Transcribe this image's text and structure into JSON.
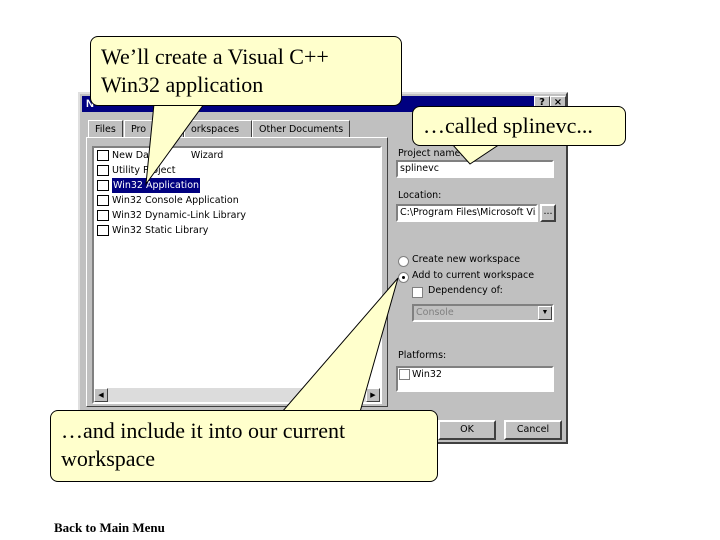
{
  "dialog": {
    "title_visible": "N",
    "title_help": "?",
    "title_close": "×",
    "tabs": [
      "Files",
      "Pro",
      "orkspaces",
      "Other Documents"
    ],
    "project_types": [
      {
        "label": "New Da",
        "label_tail": "Wizard",
        "icon": "wizard-icon"
      },
      {
        "label": "Utility Project",
        "icon": "utility-icon"
      },
      {
        "label": "Win32 Application",
        "icon": "app-icon",
        "selected": true
      },
      {
        "label": "Win32 Console Application",
        "icon": "console-icon"
      },
      {
        "label": "Win32 Dynamic-Link Library",
        "icon": "dll-icon"
      },
      {
        "label": "Win32 Static Library",
        "icon": "lib-icon"
      }
    ],
    "project_name_label": "Project name:",
    "project_name_value": "splinevc",
    "location_label": "Location:",
    "location_value": "C:\\Program Files\\Microsoft Visual",
    "browse_label": "...",
    "radio_create": "Create new workspace",
    "radio_add": "Add to current workspace",
    "dependency_label": "Dependency of:",
    "dependency_value": "Console",
    "platforms_label": "Platforms:",
    "platform_item": "Win32",
    "ok_label": "OK",
    "cancel_label": "Cancel"
  },
  "callouts": {
    "top": "We’ll create a Visual C++ Win32 application",
    "right": "…called splinevc...",
    "bottom": "…and include it into our current workspace"
  },
  "footer_link": "Back to Main Menu"
}
